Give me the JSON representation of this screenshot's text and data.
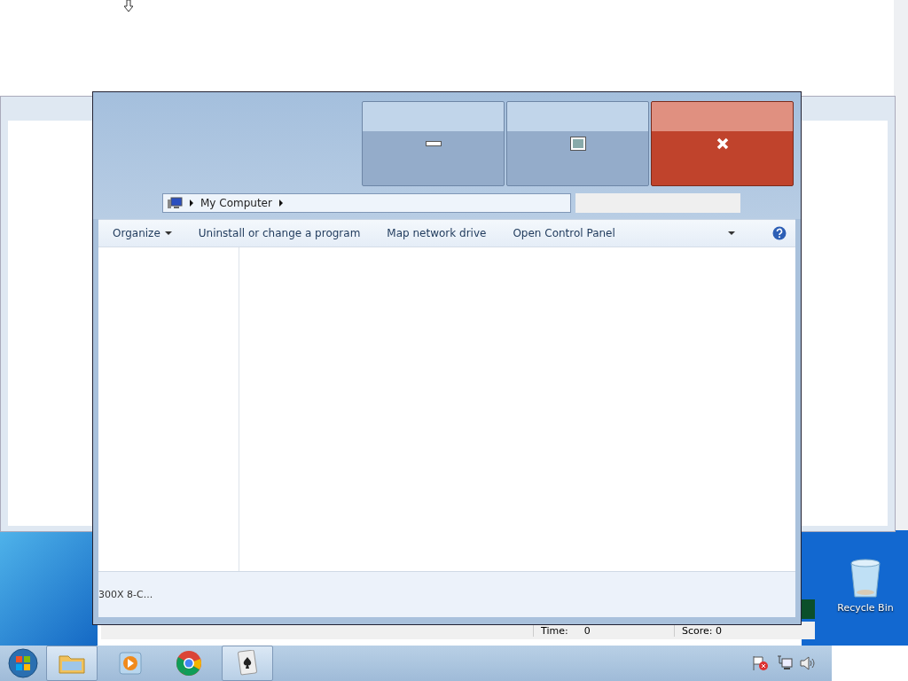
{
  "background_window": {
    "status_bar": [
      {
        "label": "Time:",
        "value": "0"
      },
      {
        "label": "Score: 0"
      }
    ]
  },
  "explorer": {
    "breadcrumb": "My Computer",
    "toolbar": [
      {
        "label": "Organize",
        "dropdown": true
      },
      {
        "label": "Uninstall or change a program",
        "dropdown": false
      },
      {
        "label": "Map network drive",
        "dropdown": false
      },
      {
        "label": "Open Control Panel",
        "dropdown": false
      }
    ],
    "details_text": "300X 8-C..."
  },
  "desktop_icons": [
    {
      "label": "Recycle Bin"
    }
  ],
  "taskbar": {
    "items": [
      {
        "kind": "folder",
        "selected": true
      },
      {
        "kind": "media",
        "selected": false
      },
      {
        "kind": "browser",
        "selected": false
      },
      {
        "kind": "cards",
        "selected": true
      }
    ]
  }
}
